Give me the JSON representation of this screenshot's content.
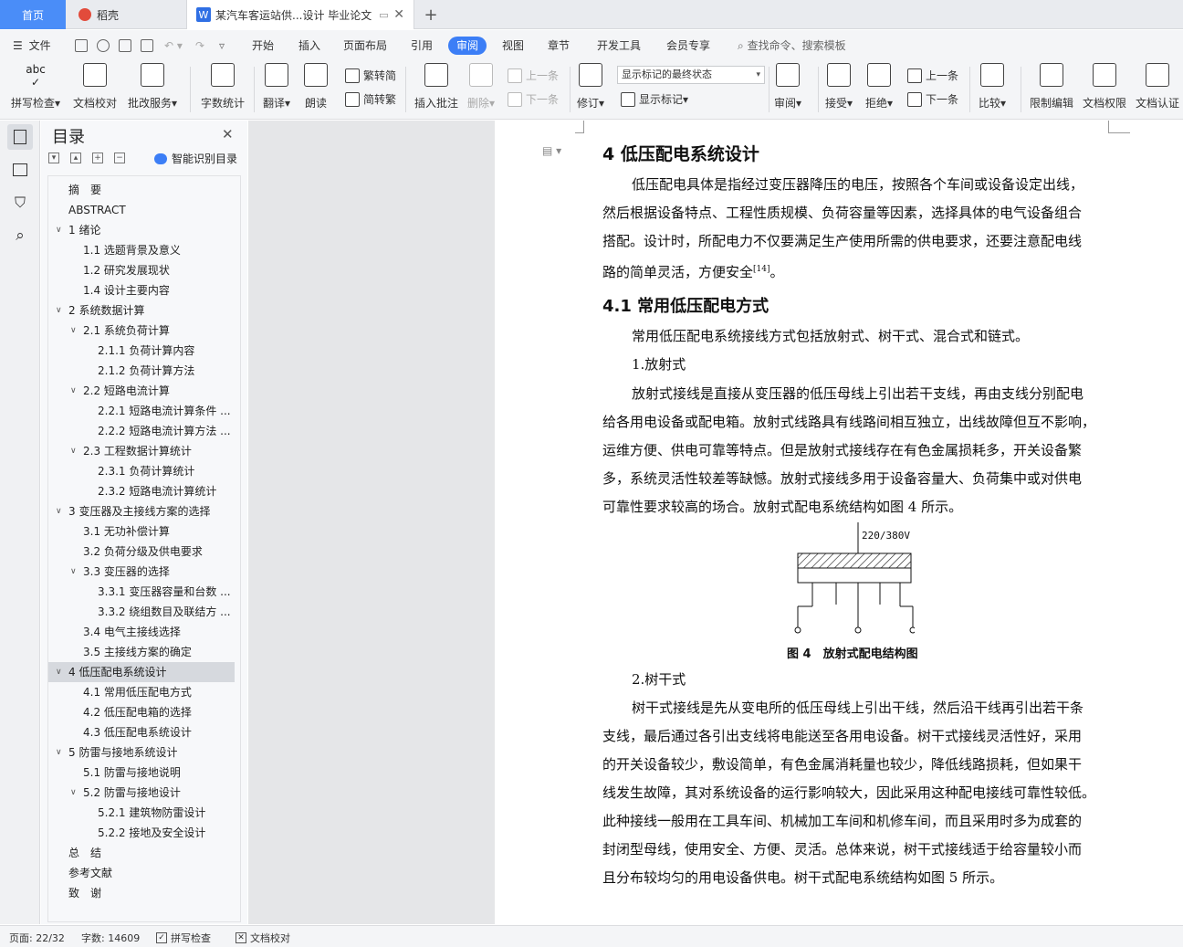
{
  "tabs": {
    "home": "首页",
    "daoke": "稻壳",
    "doc": "某汽车客运站供...设计 毕业论文",
    "add": "+"
  },
  "menu": {
    "file": "文件",
    "items": [
      "开始",
      "插入",
      "页面布局",
      "引用",
      "审阅",
      "视图",
      "章节",
      "开发工具",
      "会员专享"
    ],
    "active_index": 4,
    "search_placeholder": "查找命令、搜索模板"
  },
  "ribbon": {
    "spellcheck": "拼写检查",
    "doc_check": "文档校对",
    "batch_service": "批改服务",
    "word_count": "字数统计",
    "translate": "翻译",
    "read_aloud": "朗读",
    "trad_to_simp": "繁转简",
    "simp_to_trad": "简转繁",
    "insert_comment": "插入批注",
    "delete": "删除",
    "prev_comment": "上一条",
    "next_comment": "下一条",
    "track_changes": "修订",
    "markup_status": "显示标记的最终状态",
    "show_markup": "显示标记",
    "review": "审阅",
    "accept": "接受",
    "reject": "拒绝",
    "prev_change": "上一条",
    "next_change": "下一条",
    "compare": "比较",
    "restrict_edit": "限制编辑",
    "doc_permission": "文档权限",
    "doc_certify": "文档认证"
  },
  "nav": {
    "title": "目录",
    "smart_toc": "智能识别目录",
    "items": [
      {
        "text": "摘　要",
        "level": 0,
        "caret": ""
      },
      {
        "text": "ABSTRACT",
        "level": 0,
        "caret": ""
      },
      {
        "text": "1  绪论",
        "level": 0,
        "caret": "v"
      },
      {
        "text": "1.1  选题背景及意义",
        "level": 1,
        "caret": ""
      },
      {
        "text": "1.2  研究发展现状",
        "level": 1,
        "caret": ""
      },
      {
        "text": "1.4  设计主要内容",
        "level": 1,
        "caret": ""
      },
      {
        "text": "2  系统数据计算",
        "level": 0,
        "caret": "v"
      },
      {
        "text": "2.1  系统负荷计算",
        "level": 1,
        "caret": "v"
      },
      {
        "text": "2.1.1  负荷计算内容",
        "level": 2,
        "caret": ""
      },
      {
        "text": "2.1.2  负荷计算方法",
        "level": 2,
        "caret": ""
      },
      {
        "text": "2.2  短路电流计算",
        "level": 1,
        "caret": "v"
      },
      {
        "text": "2.2.1  短路电流计算条件 ...",
        "level": 2,
        "caret": ""
      },
      {
        "text": "2.2.2  短路电流计算方法 ...",
        "level": 2,
        "caret": ""
      },
      {
        "text": "2.3  工程数据计算统计",
        "level": 1,
        "caret": "v"
      },
      {
        "text": "2.3.1  负荷计算统计",
        "level": 2,
        "caret": ""
      },
      {
        "text": "2.3.2  短路电流计算统计",
        "level": 2,
        "caret": ""
      },
      {
        "text": "3  变压器及主接线方案的选择",
        "level": 0,
        "caret": "v"
      },
      {
        "text": "3.1  无功补偿计算",
        "level": 1,
        "caret": ""
      },
      {
        "text": "3.2  负荷分级及供电要求",
        "level": 1,
        "caret": ""
      },
      {
        "text": "3.3  变压器的选择",
        "level": 1,
        "caret": "v"
      },
      {
        "text": "3.3.1  变压器容量和台数 ...",
        "level": 2,
        "caret": ""
      },
      {
        "text": "3.3.2  绕组数目及联结方 ...",
        "level": 2,
        "caret": ""
      },
      {
        "text": "3.4  电气主接线选择",
        "level": 1,
        "caret": ""
      },
      {
        "text": "3.5  主接线方案的确定",
        "level": 1,
        "caret": ""
      },
      {
        "text": "4  低压配电系统设计",
        "level": 0,
        "caret": "v"
      },
      {
        "text": "4.1  常用低压配电方式",
        "level": 1,
        "caret": ""
      },
      {
        "text": "4.2  低压配电箱的选择",
        "level": 1,
        "caret": ""
      },
      {
        "text": "4.3  低压配电系统设计",
        "level": 1,
        "caret": ""
      },
      {
        "text": "5  防雷与接地系统设计",
        "level": 0,
        "caret": "v"
      },
      {
        "text": "5.1  防雷与接地说明",
        "level": 1,
        "caret": ""
      },
      {
        "text": "5.2  防雷与接地设计",
        "level": 1,
        "caret": "v"
      },
      {
        "text": "5.2.1  建筑物防雷设计",
        "level": 2,
        "caret": ""
      },
      {
        "text": "5.2.2  接地及安全设计",
        "level": 2,
        "caret": ""
      },
      {
        "text": "总　结",
        "level": 0,
        "caret": ""
      },
      {
        "text": "参考文献",
        "level": 0,
        "caret": ""
      },
      {
        "text": "致　谢",
        "level": 0,
        "caret": ""
      }
    ],
    "selected_index": 24
  },
  "document": {
    "heading1": "4  低压配电系统设计",
    "para1_lines": [
      "低压配电具体是指经过变压器降压的电压，按照各个车间或设备设定出线，",
      "然后根据设备特点、工程性质规模、负荷容量等因素，选择具体的电气设备组合",
      "搭配。设计时，所配电力不仅要满足生产使用所需的供电要求，还要注意配电线"
    ],
    "para1_last": "路的简单灵活，方便安全",
    "para1_ref": "[14]",
    "para1_end": "。",
    "heading2": "4.1  常用低压配电方式",
    "para2": "常用低压配电系统接线方式包括放射式、树干式、混合式和链式。",
    "item1": "1.放射式",
    "para3_lines": [
      "放射式接线是直接从变压器的低压母线上引出若干支线，再由支线分别配电",
      "给各用电设备或配电箱。放射式线路具有线路间相互独立，出线故障但互不影响，",
      "运维方便、供电可靠等特点。但是放射式接线存在有色金属损耗多，开关设备繁",
      "多，系统灵活性较差等缺憾。放射式接线多用于设备容量大、负荷集中或对供电",
      "可靠性要求较高的场合。放射式配电系统结构如图 4 所示。"
    ],
    "figure_label": "220/380V",
    "figure_caption": "图 4　放射式配电结构图",
    "item2": "2.树干式",
    "para4_lines": [
      "树干式接线是先从变电所的低压母线上引出干线，然后沿干线再引出若干条",
      "支线，最后通过各引出支线将电能送至各用电设备。树干式接线灵活性好，采用",
      "的开关设备较少，敷设简单，有色金属消耗量也较少，降低线路损耗，但如果干",
      "线发生故障，其对系统设备的运行影响较大，因此采用这种配电接线可靠性较低。",
      "此种接线一般用在工具车间、机械加工车间和机修车间，而且采用时多为成套的",
      "封闭型母线，使用安全、方便、灵活。总体来说，树干式接线适于给容量较小而",
      "且分布较均匀的用电设备供电。树干式配电系统结构如图 5 所示。"
    ]
  },
  "status": {
    "page": "页面: 22/32",
    "words": "字数: 14609",
    "spell": "拼写检查",
    "check": "文档校对"
  },
  "colors": {
    "accent": "#3c7ef6",
    "home_tab": "#4a8df8",
    "selected_toc": "#d6d9de"
  }
}
